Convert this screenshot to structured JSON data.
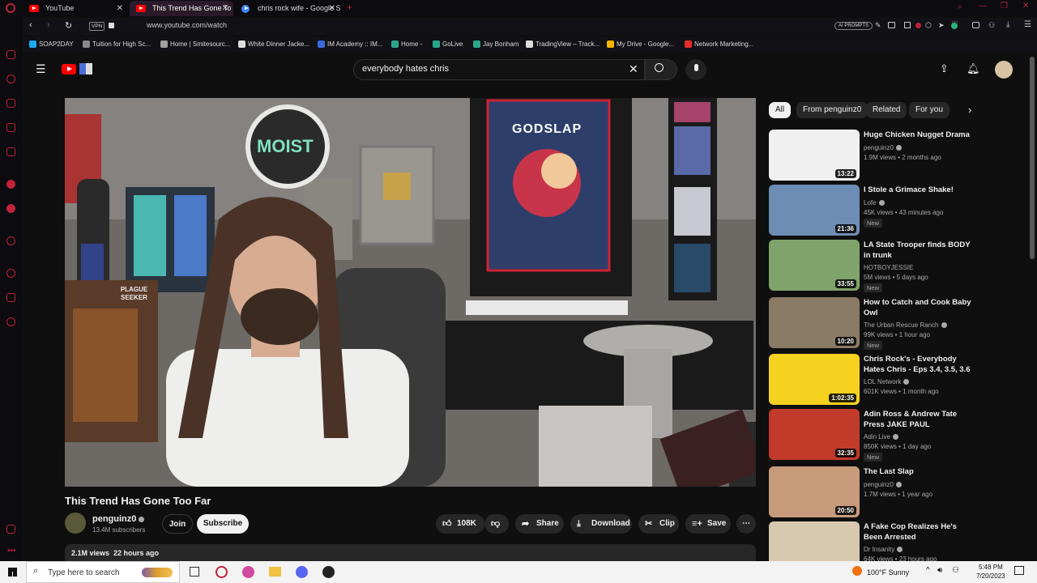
{
  "browser": {
    "tabs": [
      {
        "label": "YouTube"
      },
      {
        "label": "This Trend Has Gone To"
      },
      {
        "label": "chris rock wife - Google Se"
      }
    ],
    "url": "www.youtube.com/watch",
    "vpn_label": "VPN",
    "ai_prompts": "AI PROMPTS",
    "bookmarks": [
      {
        "label": "SOAP2DAY",
        "color": "#1ea9f0"
      },
      {
        "label": "Tuition for High Sc...",
        "color": "#888888"
      },
      {
        "label": "Home | Smitesourc...",
        "color": "#a0a0a0"
      },
      {
        "label": "White Dinner Jacke...",
        "color": "#dddddd"
      },
      {
        "label": "IM Academy :: IM...",
        "color": "#3a6ad8"
      },
      {
        "label": "Home -",
        "color": "#2aa58a"
      },
      {
        "label": "GoLive",
        "color": "#2aa58a"
      },
      {
        "label": "Jay Bonham",
        "color": "#2aa58a"
      },
      {
        "label": "TradingView – Track...",
        "color": "#dddddd"
      },
      {
        "label": "My Drive - Google...",
        "color": "#f4b400"
      },
      {
        "label": "Network Marketing...",
        "color": "#e52d27"
      }
    ]
  },
  "yt": {
    "search_value": "everybody hates chris",
    "video": {
      "title": "This Trend Has Gone Too Far",
      "channel": "penguinz0",
      "subscribers": "13.4M subscribers",
      "join_label": "Join",
      "subscribe_label": "Subscribe",
      "likes": "108K",
      "share_label": "Share",
      "download_label": "Download",
      "clip_label": "Clip",
      "save_label": "Save",
      "views": "2.1M views",
      "age": "22 hours ago",
      "poster_text": "GODSLAP",
      "logo_text": "MOIST",
      "book_text": "PLAGUE SEEKER"
    },
    "chips": [
      {
        "label": "All"
      },
      {
        "label": "From penguinz0"
      },
      {
        "label": "Related"
      },
      {
        "label": "For you"
      }
    ],
    "recommendations": [
      {
        "title": "Huge Chicken Nugget Drama",
        "channel": "penguinz0",
        "meta": "1.9M views • 2 months ago",
        "duration": "13:22",
        "is_new": false,
        "thumb_color": "#f0f0f0"
      },
      {
        "title": "I Stole a Grimace Shake!",
        "channel": "Lofe",
        "meta": "45K views • 43 minutes ago",
        "duration": "21:36",
        "is_new": true,
        "thumb_color": "#6e8db5"
      },
      {
        "title": "LA State Trooper finds BODY in trunk",
        "channel": "HOTBOYJESSIE",
        "meta": "5M views • 5 days ago",
        "duration": "33:55",
        "is_new": true,
        "thumb_color": "#7fa36a"
      },
      {
        "title": "How to Catch and Cook Baby Owl",
        "channel": "The Urban Rescue Ranch",
        "meta": "99K views • 1 hour ago",
        "duration": "10:20",
        "is_new": true,
        "thumb_color": "#8a7a66"
      },
      {
        "title": "Chris Rock's - Everybody Hates Chris - Eps 3.4, 3.5, 3.6",
        "channel": "LOL Network",
        "meta": "601K views • 1 month ago",
        "duration": "1:02:35",
        "is_new": false,
        "thumb_color": "#f5d21f"
      },
      {
        "title": "Adin Ross & Andrew Tate Press JAKE PAUL",
        "channel": "Adin Live",
        "meta": "850K views • 1 day ago",
        "duration": "32:35",
        "is_new": true,
        "thumb_color": "#c23a2a"
      },
      {
        "title": "The Last Slap",
        "channel": "penguinz0",
        "meta": "1.7M views • 1 year ago",
        "duration": "20:50",
        "is_new": false,
        "thumb_color": "#c79a7a"
      },
      {
        "title": "A Fake Cop Realizes He's Been Arrested",
        "channel": "Dr Insanity",
        "meta": "64K views • 23 hours ago",
        "duration": "",
        "is_new": false,
        "thumb_color": "#d8c8b0"
      }
    ],
    "new_label": "New"
  },
  "taskbar": {
    "search_placeholder": "Type here to search",
    "weather": "100°F  Sunny",
    "time": "5:48 PM",
    "date": "7/20/2023"
  },
  "colors": {
    "brand_red": "#ff0000",
    "accent": "#c0223a",
    "bg": "#0f0f0f"
  }
}
